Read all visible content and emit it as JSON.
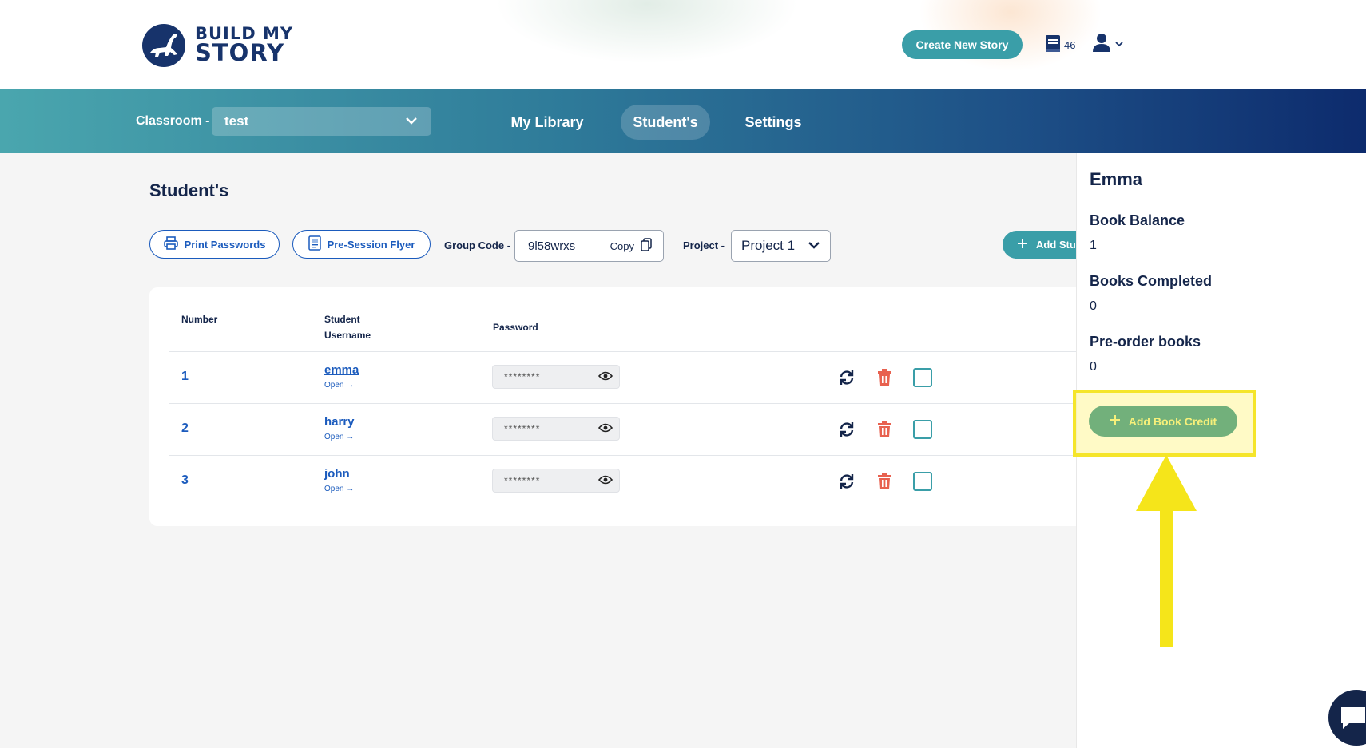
{
  "brand": {
    "line1": "BUILD MY",
    "line2": "STORY"
  },
  "header": {
    "create_label": "Create New Story",
    "book_count": "46"
  },
  "nav": {
    "classroom_label": "Classroom -",
    "classroom_value": "test",
    "items": [
      {
        "label": "My Library"
      },
      {
        "label": "Student's"
      },
      {
        "label": "Settings"
      }
    ]
  },
  "page": {
    "title": "Student's",
    "print_label": "Print Passwords",
    "flyer_label": "Pre-Session Flyer",
    "group_code_label": "Group Code -",
    "group_code": "9l58wrxs",
    "copy_label": "Copy",
    "project_label": "Project -",
    "project_value": "Project 1",
    "add_student_label": "Add Stu"
  },
  "table": {
    "headers": {
      "number": "Number",
      "username_line1": "Student",
      "username_line2": "Username",
      "password": "Password"
    },
    "rows": [
      {
        "number": "1",
        "username": "emma",
        "open": "Open →",
        "password": "********"
      },
      {
        "number": "2",
        "username": "harry",
        "open": "Open →",
        "password": "********"
      },
      {
        "number": "3",
        "username": "john",
        "open": "Open →",
        "password": "********"
      }
    ]
  },
  "side_panel": {
    "name": "Emma",
    "book_balance_label": "Book Balance",
    "book_balance": "1",
    "books_completed_label": "Books Completed",
    "books_completed": "0",
    "preorder_label": "Pre-order books",
    "preorder": "0",
    "add_credit_label": "Add Book Credit"
  },
  "colors": {
    "teal": "#3a9ea8",
    "navy": "#14254a",
    "link_blue": "#1b5bbd",
    "highlight": "#f5e52a",
    "danger": "#e8614f"
  }
}
